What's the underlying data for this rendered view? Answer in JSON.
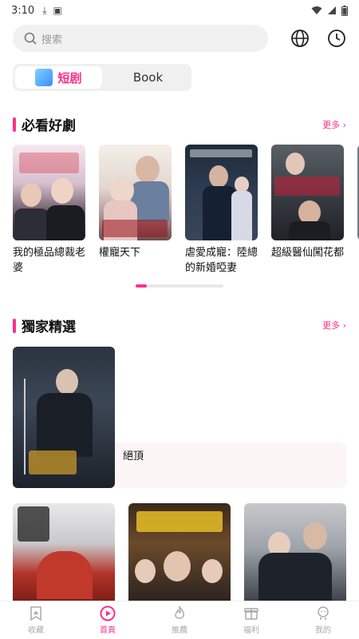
{
  "status": {
    "time": "3:10"
  },
  "search": {
    "placeholder": "搜索"
  },
  "tabs": [
    {
      "label": "短剧",
      "active": true
    },
    {
      "label": "Book",
      "active": false
    }
  ],
  "sections": {
    "must_watch": {
      "title": "必看好劇",
      "more": "更多 ›"
    },
    "exclusive": {
      "title": "獨家精選",
      "more": "更多 ›"
    }
  },
  "must_watch_items": [
    {
      "title": "我的極品總裁老婆"
    },
    {
      "title": "權寵天下"
    },
    {
      "title": "虐愛成寵：陸總的新婚啞妻"
    },
    {
      "title": "超級醫仙闖花都"
    }
  ],
  "featured": {
    "title": "絕頂"
  },
  "bottom_nav": [
    {
      "label": "收藏",
      "icon": "bookmark-star-icon",
      "active": false
    },
    {
      "label": "首頁",
      "icon": "play-circle-icon",
      "active": true
    },
    {
      "label": "推薦",
      "icon": "flame-icon",
      "active": false
    },
    {
      "label": "福利",
      "icon": "gift-icon",
      "active": false
    },
    {
      "label": "我的",
      "icon": "profile-icon",
      "active": false
    }
  ],
  "colors": {
    "accent": "#ff2e88",
    "search_bg": "#f1f1f1",
    "tab_bg": "#f0f0f0"
  }
}
